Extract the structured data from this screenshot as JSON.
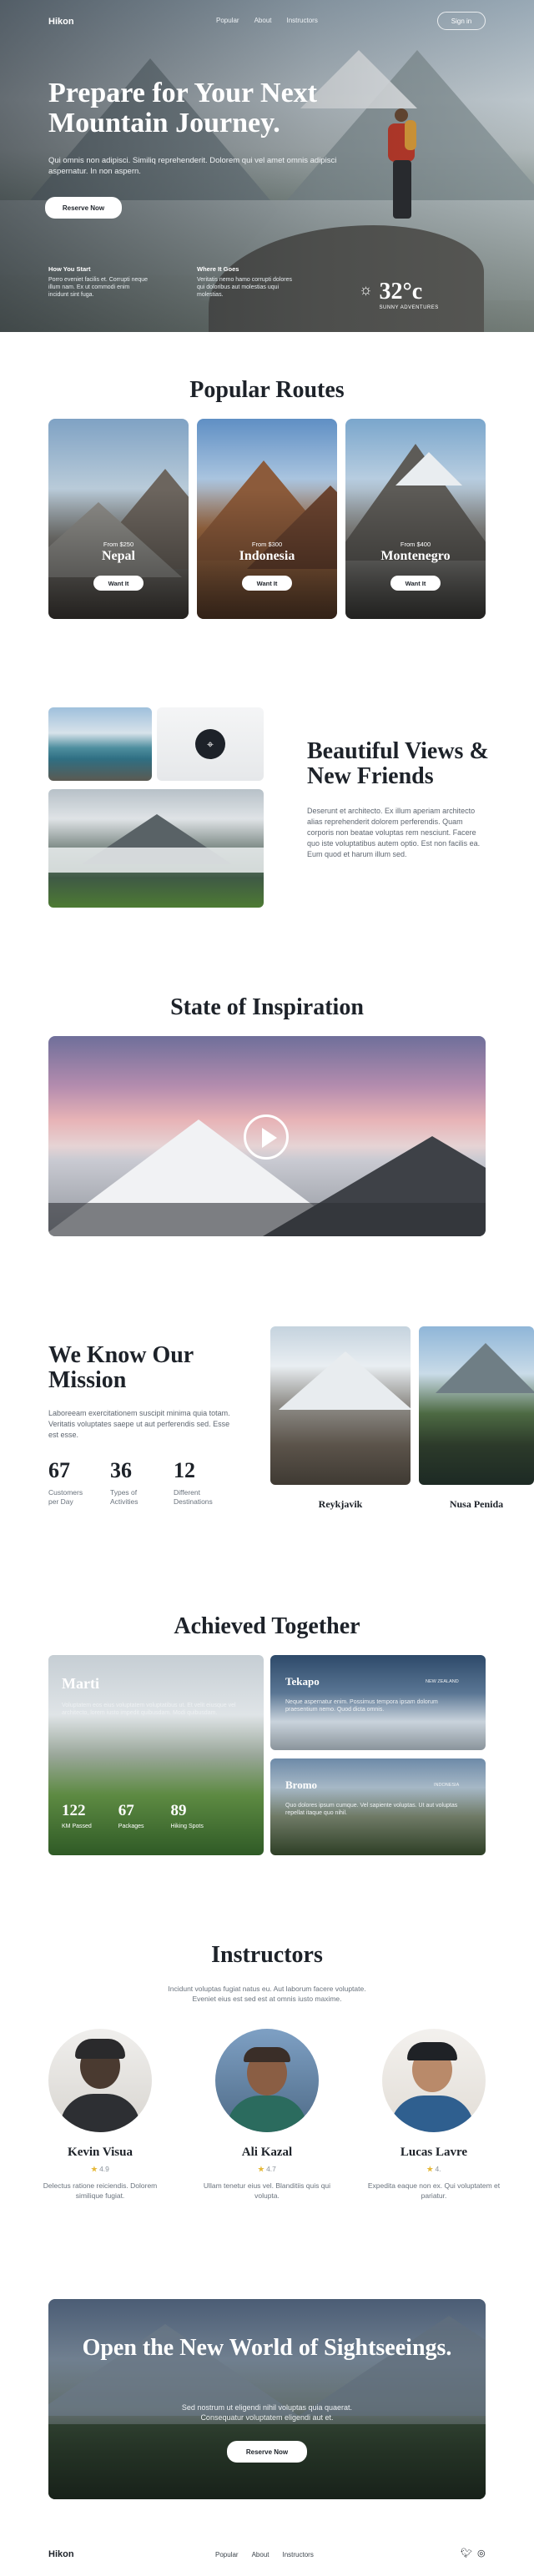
{
  "nav": {
    "logo": "Hikon",
    "links": [
      "Popular",
      "About",
      "Instructors"
    ],
    "signin": "Sign in"
  },
  "hero": {
    "title": "Prepare for Your Next Mountain Journey.",
    "subtitle": "Qui omnis non adipisci. Similiq reprehenderit. Dolorem qui vel amet omnis adipisci aspernatur. In non aspern.",
    "cta": "Reserve Now",
    "columns": [
      {
        "heading": "How You Start",
        "text": "Porro eveniet facilis et. Corrupti neque illum nam. Ex ut commodi enim incidunt sint fuga."
      },
      {
        "heading": "Where It Goes",
        "text": "Veritatis nemo hamo corrupti dolores qui doloribus aut molestias uqui molestias."
      }
    ],
    "weather": {
      "temp": "32°c",
      "caption": "SUNNY ADVENTURES"
    }
  },
  "routes": {
    "title": "Popular Routes",
    "items": [
      {
        "from": "From $250",
        "name": "Nepal",
        "button": "Want It"
      },
      {
        "from": "From $300",
        "name": "Indonesia",
        "button": "Want It"
      },
      {
        "from": "From $400",
        "name": "Montenegro",
        "button": "Want It"
      }
    ]
  },
  "views": {
    "title": "Beautiful Views & New Friends",
    "text": "Deserunt et architecto. Ex illum aperiam architecto alias reprehenderit dolorem perferendis. Quam corporis non beatae voluptas rem nesciunt. Facere quo iste voluptatibus autem optio. Est non facilis ea. Eum quod et harum illum sed."
  },
  "inspiration": {
    "title": "State of Inspiration"
  },
  "mission": {
    "title": "We Know Our Mission",
    "text": "Laboreeam exercitationem suscipit minima quia totam. Veritatis voluptates saepe ut aut perferendis sed. Esse est esse.",
    "stats": [
      {
        "value": "67",
        "label": "Customers per Day"
      },
      {
        "value": "36",
        "label": "Types of Activities"
      },
      {
        "value": "12",
        "label": "Different Destinations"
      }
    ],
    "destinations": [
      "Reykjavik",
      "Nusa Penida"
    ]
  },
  "achieved": {
    "title": "Achieved Together",
    "main": {
      "name": "Marti",
      "text": "Voluptatem eos eius voluptatem voluptatibus ut. Et velit eiusque vel architecto, lorem iusto impedit quibusdam. Modi quibusdam.",
      "stats": [
        {
          "value": "122",
          "label": "KM Passed"
        },
        {
          "value": "67",
          "label": "Packages"
        },
        {
          "value": "89",
          "label": "Hiking Spots"
        }
      ]
    },
    "side": [
      {
        "name": "Tekapo",
        "badge": "NEW ZEALAND",
        "text": "Neque aspernatur enim. Possimus tempora ipsam dolorum praesentium nemo. Quod dicta omnis."
      },
      {
        "name": "Bromo",
        "badge": "INDONESIA",
        "text": "Quo dolores ipsum cumque. Vel sapiente voluptas. Ut aut voluptas repellat itaque quo nihil."
      }
    ]
  },
  "instructors": {
    "title": "Instructors",
    "subtitle": "Incidunt voluptas fugiat natus eu. Aut laborum facere voluptate. Eveniet eius est sed est at omnis iusto maxime.",
    "people": [
      {
        "name": "Kevin Visua",
        "rating": "4.9",
        "desc": "Delectus ratione reiciendis. Dolorem similique fugiat."
      },
      {
        "name": "Ali Kazal",
        "rating": "4.7",
        "desc": "Ullam tenetur eius vel. Blanditiis quis qui volupta."
      },
      {
        "name": "Lucas Lavre",
        "rating": "4.",
        "desc": "Expedita eaque non ex. Qui voluptatem et pariatur."
      }
    ]
  },
  "cta": {
    "title": "Open the New World of Sightseeings.",
    "subtitle": "Sed nostrum ut eligendi nihil voluptas quia quaerat. Consequatur voluptatem eligendi aut et.",
    "button": "Reserve Now"
  },
  "footer": {
    "logo": "Hikon",
    "links": [
      "Popular",
      "About",
      "Instructors"
    ]
  }
}
